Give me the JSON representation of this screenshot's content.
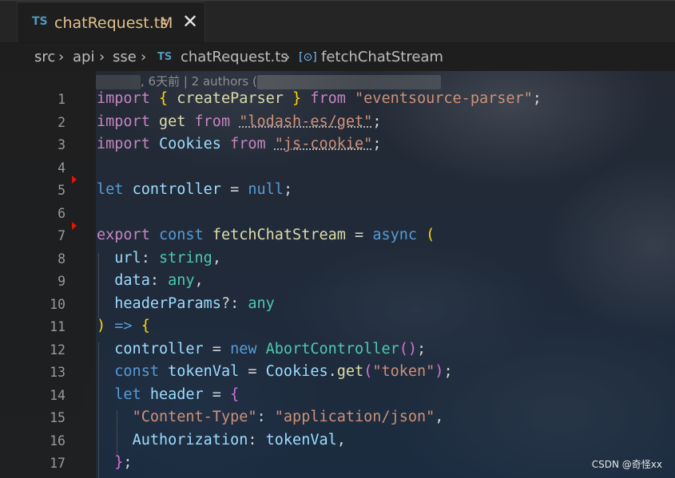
{
  "tab": {
    "lang_badge": "TS",
    "filename": "chatRequest.ts",
    "modified": "M",
    "close_glyph": "✕"
  },
  "breadcrumb": {
    "parts": [
      "src",
      "api",
      "sse"
    ],
    "file_badge": "TS",
    "file": "chatRequest.ts",
    "symbol_icon": "[⊙]",
    "symbol": "fetchChatStream"
  },
  "blame": {
    "text": ", 6天前 | 2 authors ("
  },
  "lines": [
    {
      "n": "1"
    },
    {
      "n": "2"
    },
    {
      "n": "3"
    },
    {
      "n": "4"
    },
    {
      "n": "5"
    },
    {
      "n": "6"
    },
    {
      "n": "7"
    },
    {
      "n": "8"
    },
    {
      "n": "9"
    },
    {
      "n": "10"
    },
    {
      "n": "11"
    },
    {
      "n": "12"
    },
    {
      "n": "13"
    },
    {
      "n": "14"
    },
    {
      "n": "15"
    },
    {
      "n": "16"
    },
    {
      "n": "17"
    }
  ],
  "code": {
    "l1": {
      "a": "import",
      "b": " ",
      "c": "{",
      "d": " ",
      "e": "createParser",
      "f": " ",
      "g": "}",
      "h": " ",
      "i": "from",
      "j": " ",
      "k": "\"eventsource-parser\"",
      "l": ";"
    },
    "l2": {
      "a": "import",
      "b": " ",
      "c": "get",
      "d": " ",
      "e": "from",
      "f": " ",
      "g": "\"lodash-es/get\"",
      "h": ";"
    },
    "l3": {
      "a": "import",
      "b": " ",
      "c": "Cookies",
      "d": " ",
      "e": "from",
      "f": " ",
      "g": "\"js-cookie\"",
      "h": ";"
    },
    "l5": {
      "a": "let",
      "b": " ",
      "c": "controller",
      "d": " = ",
      "e": "null",
      "f": ";"
    },
    "l7": {
      "a": "export",
      "b": " ",
      "c": "const",
      "d": " ",
      "e": "fetchChatStream",
      "f": " = ",
      "g": "async",
      "h": " ",
      "i": "("
    },
    "l8": {
      "a": "  ",
      "b": "url",
      "c": ": ",
      "d": "string",
      "e": ","
    },
    "l9": {
      "a": "  ",
      "b": "data",
      "c": ": ",
      "d": "any",
      "e": ","
    },
    "l10": {
      "a": "  ",
      "b": "headerParams",
      "c": "?: ",
      "d": "any"
    },
    "l11": {
      "a": ")",
      "b": " => ",
      "c": "{"
    },
    "l12": {
      "a": "  ",
      "b": "controller",
      "c": " = ",
      "d": "new",
      "e": " ",
      "f": "AbortController",
      "g": "()",
      "h": ";"
    },
    "l13": {
      "a": "  ",
      "b": "const",
      "c": " ",
      "d": "tokenVal",
      "e": " = ",
      "f": "Cookies",
      "g": ".",
      "h": "get",
      "i": "(",
      "j": "\"token\"",
      "k": ")",
      "l": ";"
    },
    "l14": {
      "a": "  ",
      "b": "let",
      "c": " ",
      "d": "header",
      "e": " = ",
      "f": "{"
    },
    "l15": {
      "a": "    ",
      "b": "\"Content-Type\"",
      "c": ": ",
      "d": "\"application/json\"",
      "e": ","
    },
    "l16": {
      "a": "    ",
      "b": "Authorization",
      "c": ": ",
      "d": "tokenVal",
      "e": ","
    },
    "l17": {
      "a": "  ",
      "b": "}",
      "c": ";"
    }
  },
  "watermark": "CSDN @奇怪xx",
  "colors": {
    "keyword": "#c586c0",
    "declaration": "#569cd6",
    "variable": "#9cdcfe",
    "function": "#dcdcaa",
    "string": "#ce9178",
    "type": "#4ec9b0",
    "tab_modified": "#e2c08d",
    "ts_badge": "#519aba"
  }
}
